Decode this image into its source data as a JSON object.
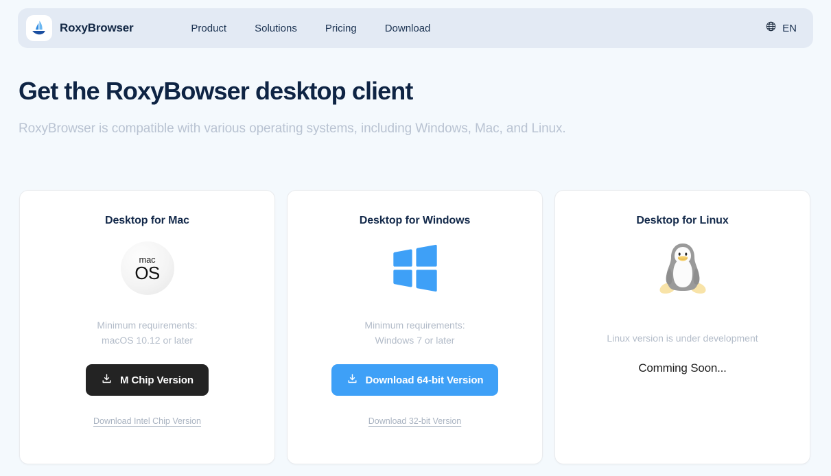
{
  "header": {
    "logo_icon": "sailboat-logo-icon",
    "brand_name": "RoxyBrowser",
    "nav": [
      {
        "label": "Product"
      },
      {
        "label": "Solutions"
      },
      {
        "label": "Pricing"
      },
      {
        "label": "Download"
      }
    ],
    "language": {
      "icon": "globe-icon",
      "code": "EN"
    },
    "bar_color": "#e3eaf4"
  },
  "hero": {
    "title": "Get the RoxyBowser desktop client",
    "subtitle": "RoxyBrowser is compatible with various operating systems, including Windows, Mac, and Linux."
  },
  "cards": [
    {
      "title": "Desktop for Mac",
      "icon": "macos-logo-icon",
      "macos_top": "mac",
      "macos_bottom": "OS",
      "req_line1": "Minimum requirements:",
      "req_line2": "macOS 10.12 or later",
      "button_label": "M Chip Version",
      "button_icon": "download-icon",
      "button_color": "#232323",
      "alt_link": "Download Intel Chip Version"
    },
    {
      "title": "Desktop for Windows",
      "icon": "windows-logo-icon",
      "req_line1": "Minimum requirements:",
      "req_line2": "Windows 7 or later",
      "button_label": "Download 64-bit Version",
      "button_icon": "download-icon",
      "button_color": "#3ea0f7",
      "alt_link": "Download 32-bit Version"
    },
    {
      "title": "Desktop for Linux",
      "icon": "linux-tux-logo-icon",
      "note": "Linux version is under development",
      "status": "Comming Soon..."
    }
  ],
  "colors": {
    "page_background": "#f4f9fd",
    "accent_blue": "#3ea0f7",
    "text_navy": "#13294a",
    "muted_gray": "#b3bcc9"
  }
}
